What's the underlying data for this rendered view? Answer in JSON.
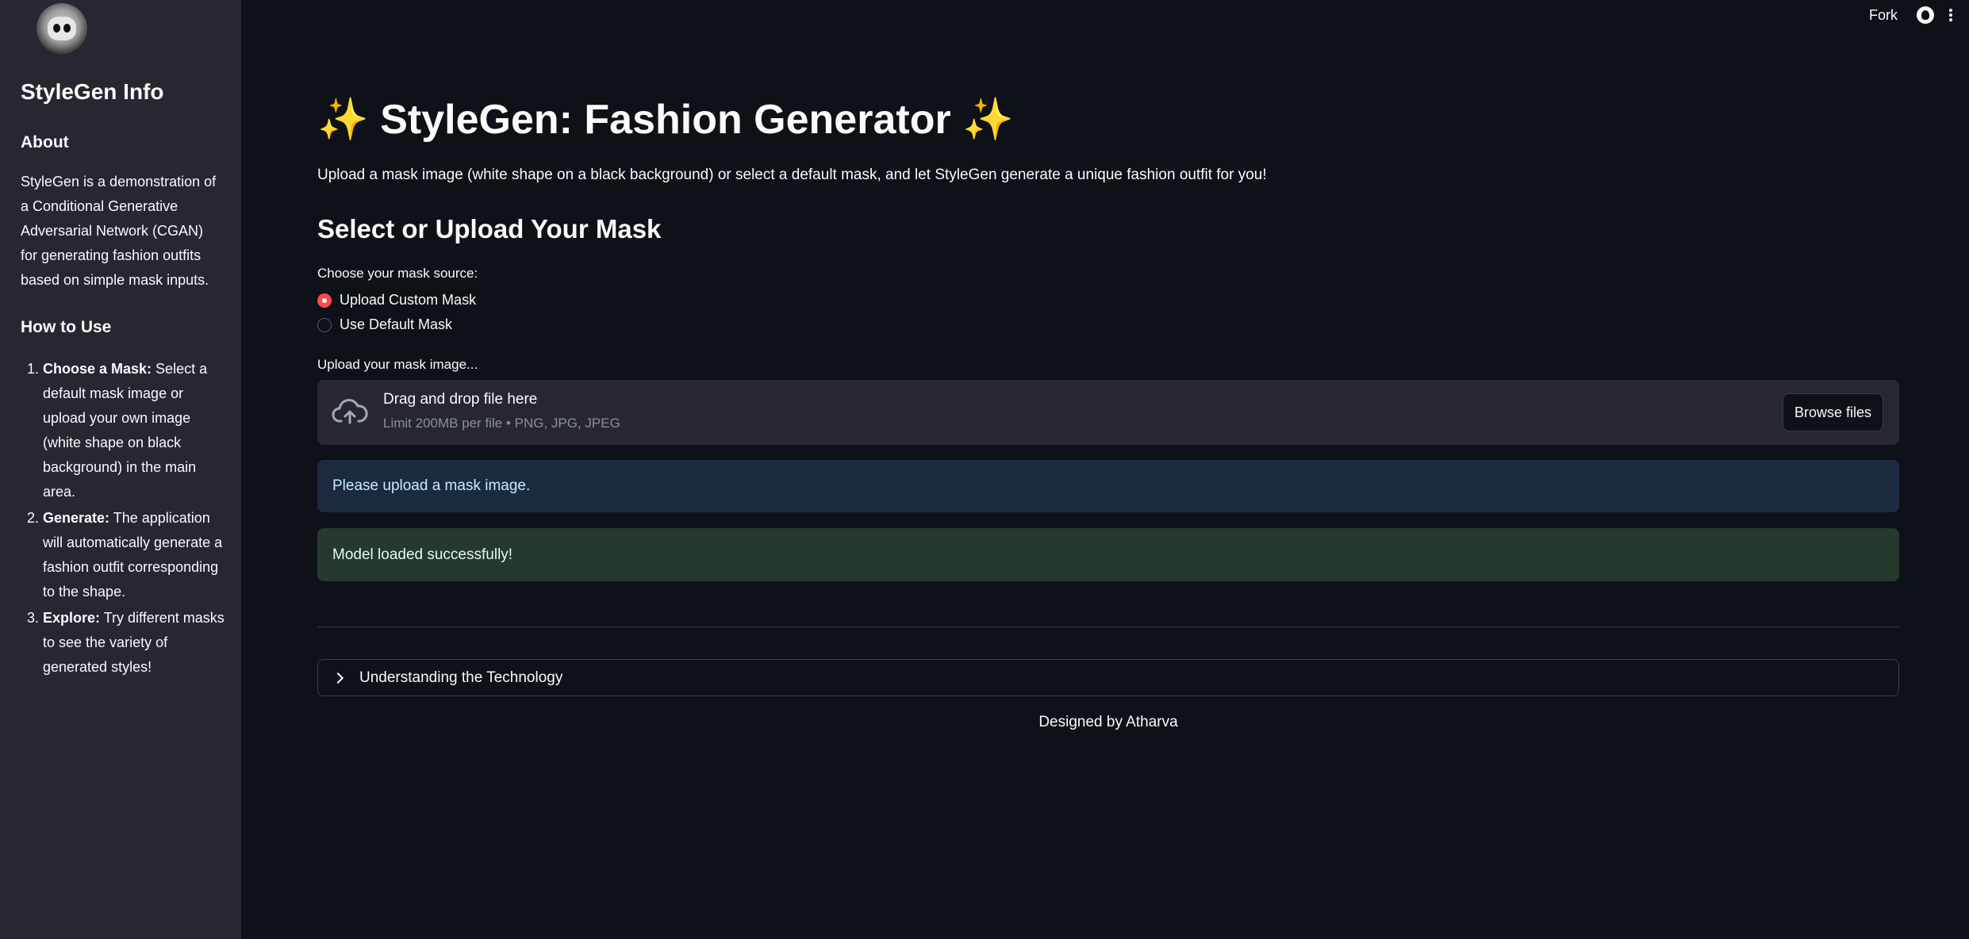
{
  "sidebar": {
    "title": "StyleGen Info",
    "about_title": "About",
    "about_text": "StyleGen is a demonstration of a Conditional Generative Adversarial Network (CGAN) for generating fashion outfits based on simple mask inputs.",
    "howto_title": "How to Use",
    "steps": [
      {
        "bold": "Choose a Mask:",
        "text": " Select a default mask image or upload your own image (white shape on black background) in the main area."
      },
      {
        "bold": "Generate:",
        "text": " The application will automatically generate a fashion outfit corresponding to the shape."
      },
      {
        "bold": "Explore:",
        "text": " Try different masks to see the variety of generated styles!"
      }
    ]
  },
  "toolbar": {
    "fork_label": "Fork",
    "github_icon": "github-icon",
    "menu_icon": "vertical-dots-icon"
  },
  "main": {
    "sparkle": "✨",
    "title": "StyleGen: Fashion Generator",
    "subtitle": "Upload a mask image (white shape on a black background) or select a default mask, and let StyleGen generate a unique fashion outfit for you!",
    "section_title": "Select or Upload Your Mask",
    "radio_label": "Choose your mask source:",
    "radio_options": [
      "Upload Custom Mask",
      "Use Default Mask"
    ],
    "radio_selected": "Upload Custom Mask",
    "upload_label": "Upload your mask image...",
    "drop_title": "Drag and drop file here",
    "drop_limit": "Limit 200MB per file • PNG, JPG, JPEG",
    "browse_label": "Browse files",
    "info_message": "Please upload a mask image.",
    "success_message": "Model loaded successfully!",
    "expander_label": "Understanding the Technology",
    "footer": "Designed by Atharva"
  },
  "colors": {
    "background": "#0e1117",
    "sidebar": "#262730",
    "accent": "#ff4b4b",
    "info_bg": "#1c2a40",
    "success_bg": "#253a2d"
  }
}
